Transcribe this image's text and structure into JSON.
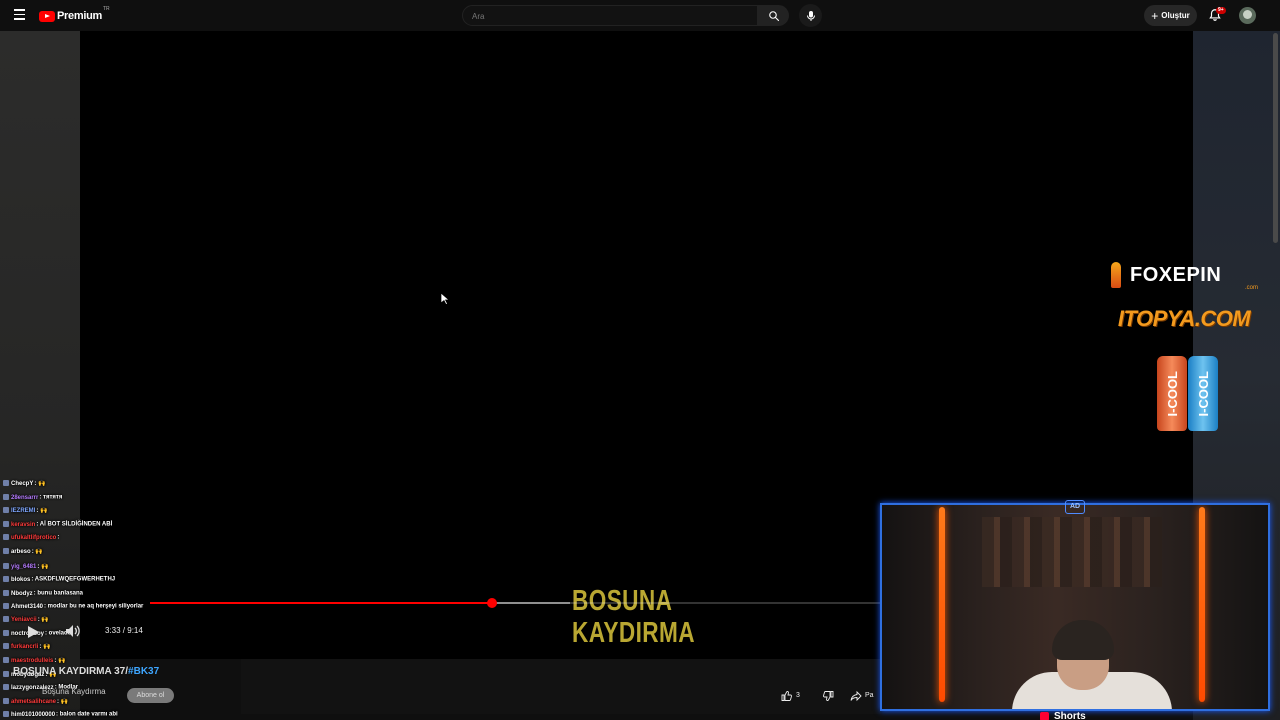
{
  "header": {
    "logo_text": "Premium",
    "logo_country": "TR",
    "search_placeholder": "Ara",
    "create_label": "Oluştur",
    "notification_badge": "9+"
  },
  "player": {
    "time_display": "3:33 / 9:14",
    "progress_fraction": 0.466,
    "title_art_line1": "BOSUNA",
    "title_art_line2": "KAYDIRMA"
  },
  "video": {
    "title": "BOŞUNA KAYDIRMA 37/",
    "hashtag": "#BK37",
    "channel": "Boşuna Kaydırma",
    "subscribe_label": "Abone ol",
    "like_count": "3",
    "share_label": "Pa"
  },
  "sponsors": {
    "foxepin_main": "FOXEPIN",
    "foxepin_sub": ".com",
    "itopya": "ITOPYA.COM",
    "can1": "I-COOL",
    "can2": "I-COOL"
  },
  "chat": [
    {
      "user": "ChecpY",
      "msg": ": 🙌",
      "color": "#ffffff"
    },
    {
      "user": "28ensarrr",
      "msg": ": тятятя",
      "color": "#b57bff"
    },
    {
      "user": "IEZREMI",
      "msg": ": 🙌",
      "color": "#7fa7ff"
    },
    {
      "user": "keravsin",
      "msg": ": Aİ BOT SİLDİĞİNDEN ABİ",
      "color": "#ff3b3b"
    },
    {
      "user": "ufukaltlifprotico",
      "msg": ": ",
      "color": "#ff3b3b"
    },
    {
      "user": "arbeso",
      "msg": ": 🙌",
      "color": "#ffffff"
    },
    {
      "user": "yig_6481",
      "msg": ": 🙌",
      "color": "#b57bff"
    },
    {
      "user": "blokos",
      "msg": ": ASKDFLWQEFGWERHETHJ",
      "color": "#ffffff"
    },
    {
      "user": "Nbodyz",
      "msg": ": bunu banlasana",
      "color": "#ffffff"
    },
    {
      "user": "Ahmet3140",
      "msg": ": modlar bu ne aq herşeyi siliyorlar",
      "color": "#ffffff"
    },
    {
      "user": "Yeniavcii",
      "msg": ": 🙌",
      "color": "#ff3b3b"
    },
    {
      "user": "noctronboy",
      "msg": ": ovelade",
      "color": "#ffffff"
    },
    {
      "user": "furkancrli",
      "msg": ": 🙌",
      "color": "#ff3b3b"
    },
    {
      "user": "maestrodulleis",
      "msg": ": 🙌",
      "color": "#ff3b3b"
    },
    {
      "user": "mobydogaz",
      "msg": ": 🙌",
      "color": "#ffffff"
    },
    {
      "user": "lazzygonzalezz",
      "msg": ": Modlar",
      "color": "#ffffff"
    },
    {
      "user": "ahmetsalihcane",
      "msg": ": 🙌",
      "color": "#ff3b3b"
    },
    {
      "user": "him0101000000",
      "msg": ": balon date varmı abi",
      "color": "#ffffff"
    }
  ],
  "shorts_label": "Shorts",
  "colors": {
    "accent_red": "#ff0000",
    "webcam_border": "#2f6fe0",
    "neon_orange": "#ff5a00",
    "title_art": "#b9a732"
  },
  "icons": [
    "menu-icon",
    "youtube-logo-icon",
    "search-icon",
    "mic-icon",
    "plus-icon",
    "bell-icon",
    "play-icon",
    "volume-icon",
    "like-icon",
    "dislike-icon",
    "share-icon",
    "shorts-icon"
  ]
}
